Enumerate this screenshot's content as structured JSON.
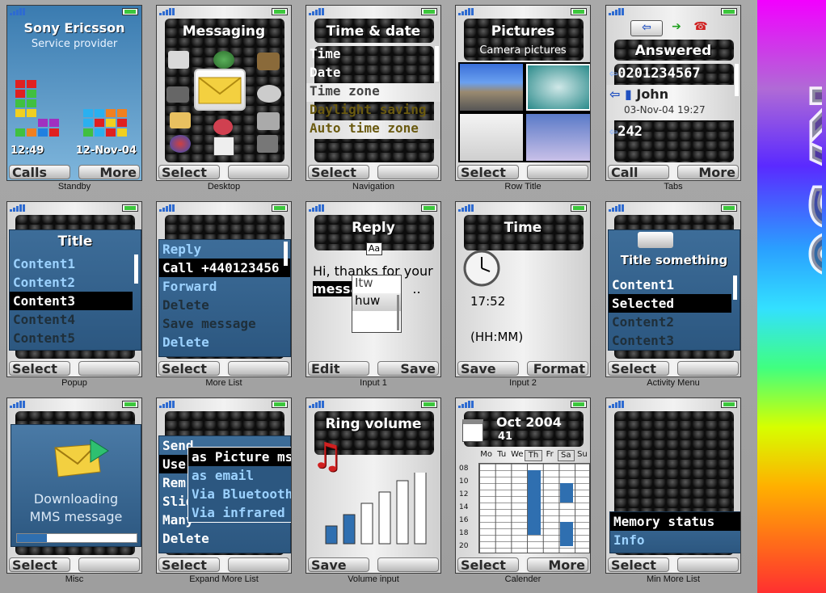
{
  "brand": {
    "model": "K750"
  },
  "cells": {
    "standby": {
      "caption": "Standby",
      "operator": "Sony Ericsson",
      "provider": "Service provider",
      "time": "12:49",
      "date": "12-Nov-04",
      "left_key": "Calls",
      "right_key": "More"
    },
    "desktop": {
      "caption": "Desktop",
      "title": "Messaging",
      "left_key": "Select",
      "right_key": ""
    },
    "navigation": {
      "caption": "Navigation",
      "title": "Time & date",
      "items": [
        "Time",
        "Date",
        "Time zone",
        "Daylight saving",
        "Auto time zone"
      ],
      "left_key": "Select",
      "right_key": ""
    },
    "rowtitle": {
      "caption": "Row Title",
      "title": "Pictures",
      "subtitle": "Camera pictures",
      "left_key": "Select",
      "right_key": ""
    },
    "tabs": {
      "caption": "Tabs",
      "title": "Answered",
      "number1": "0201234567",
      "name": "John",
      "datetime": "03-Nov-04 19:27",
      "number2": "242",
      "left_key": "Call",
      "right_key": "More"
    },
    "popup": {
      "caption": "Popup",
      "title": "Title",
      "items": [
        "Content1",
        "Content2",
        "Content3",
        "Content4",
        "Content5"
      ],
      "left_key": "Select",
      "right_key": ""
    },
    "morelist": {
      "caption": "More List",
      "items": [
        "Reply",
        "Call +440123456",
        "Forward",
        "Delete",
        "Save message",
        "Delete"
      ],
      "left_key": "Select",
      "right_key": ""
    },
    "input1": {
      "caption": "Input 1",
      "title": "Reply",
      "mode": "Aa",
      "text_line1": "Hi, thanks for your",
      "text_word": "messa",
      "text_rest": "..",
      "suggestions": [
        "Itw",
        "huw"
      ],
      "left_key": "Edit",
      "right_key": "Save"
    },
    "input2": {
      "caption": "Input 2",
      "title": "Time",
      "hour": "17",
      "minute": "52",
      "format": "(HH:MM)",
      "left_key": "Save",
      "right_key": "Format"
    },
    "activitymenu": {
      "caption": "Activity Menu",
      "title": "Title something",
      "items": [
        "Content1",
        "Selected",
        "Content2",
        "Content3"
      ],
      "left_key": "Select",
      "right_key": ""
    },
    "misc": {
      "caption": "Misc",
      "line1": "Downloading",
      "line2": "MMS message",
      "progress": 0.25,
      "left_key": "Select",
      "right_key": ""
    },
    "expandmore": {
      "caption": "Expand More List",
      "items": [
        "Send",
        "Use",
        "Rem",
        "Slide",
        "Many",
        "Delete"
      ],
      "submenu": [
        "as Picture msg",
        "as email",
        "Via Bluetooth",
        "Via infrared"
      ],
      "left_key": "Select",
      "right_key": ""
    },
    "volume": {
      "caption": "Volume input",
      "title": "Ring volume",
      "level": 2,
      "max": 6,
      "left_key": "Save",
      "right_key": ""
    },
    "calendar": {
      "caption": "Calender",
      "month": "Oct 2004",
      "week": "41",
      "days": [
        "Mo",
        "Tu",
        "We",
        "Th",
        "Fr",
        "Sa",
        "Su"
      ],
      "hours": [
        "08",
        "10",
        "12",
        "14",
        "16",
        "18",
        "20"
      ],
      "left_key": "Select",
      "right_key": "More"
    },
    "minmore": {
      "caption": "Min More List",
      "items": [
        "Memory status",
        "Info"
      ],
      "left_key": "Select",
      "right_key": ""
    }
  }
}
